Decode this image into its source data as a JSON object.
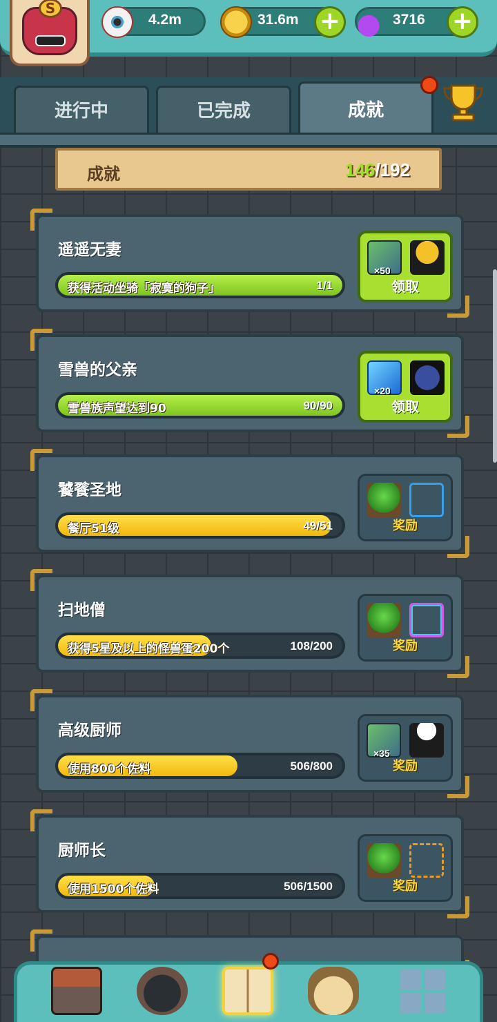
{
  "resources": {
    "eyes": "4.2m",
    "coins": "31.6m",
    "potion": "3716",
    "avatar_badge": "S"
  },
  "tabs": [
    {
      "label": "进行中"
    },
    {
      "label": "已完成"
    },
    {
      "label": "成就"
    }
  ],
  "summary": {
    "label": "成就",
    "got": "146",
    "total": "/192"
  },
  "achievements": [
    {
      "title": "遥遥无妻",
      "task": "获得活动坐骑「寂寞的狗子」",
      "progress_text": "1/1",
      "progress": 1.0,
      "bar_color": "green",
      "reward_label": "领取",
      "reward_qty": "×50",
      "claimable": true
    },
    {
      "title": "雪兽的父亲",
      "task": "雪兽族声望达到90",
      "progress_text": "90/90",
      "progress": 1.0,
      "bar_color": "green",
      "reward_label": "领取",
      "reward_qty": "×20",
      "claimable": true
    },
    {
      "title": "饕餮圣地",
      "task": "餐厅51级",
      "progress_text": "49/51",
      "progress": 0.96,
      "bar_color": "yellow",
      "reward_label": "奖励",
      "claimable": false
    },
    {
      "title": "扫地僧",
      "task": "获得5星及以上的怪兽蛋200个",
      "progress_text": "108/200",
      "progress": 0.54,
      "bar_color": "yellow",
      "reward_label": "奖励",
      "claimable": false
    },
    {
      "title": "高级厨师",
      "task": "使用800个佐料",
      "progress_text": "506/800",
      "progress": 0.63,
      "bar_color": "yellow",
      "reward_label": "奖励",
      "reward_qty": "×35",
      "claimable": false
    },
    {
      "title": "厨师长",
      "task": "使用1500个佐料",
      "progress_text": "506/1500",
      "progress": 0.34,
      "bar_color": "yellow",
      "reward_label": "奖励",
      "claimable": false
    }
  ],
  "colors": {
    "topbar": "#5dbfbb",
    "green_fill": "#a8e031",
    "yellow_fill": "#f1b80c",
    "badge_red": "#ee4a18"
  }
}
